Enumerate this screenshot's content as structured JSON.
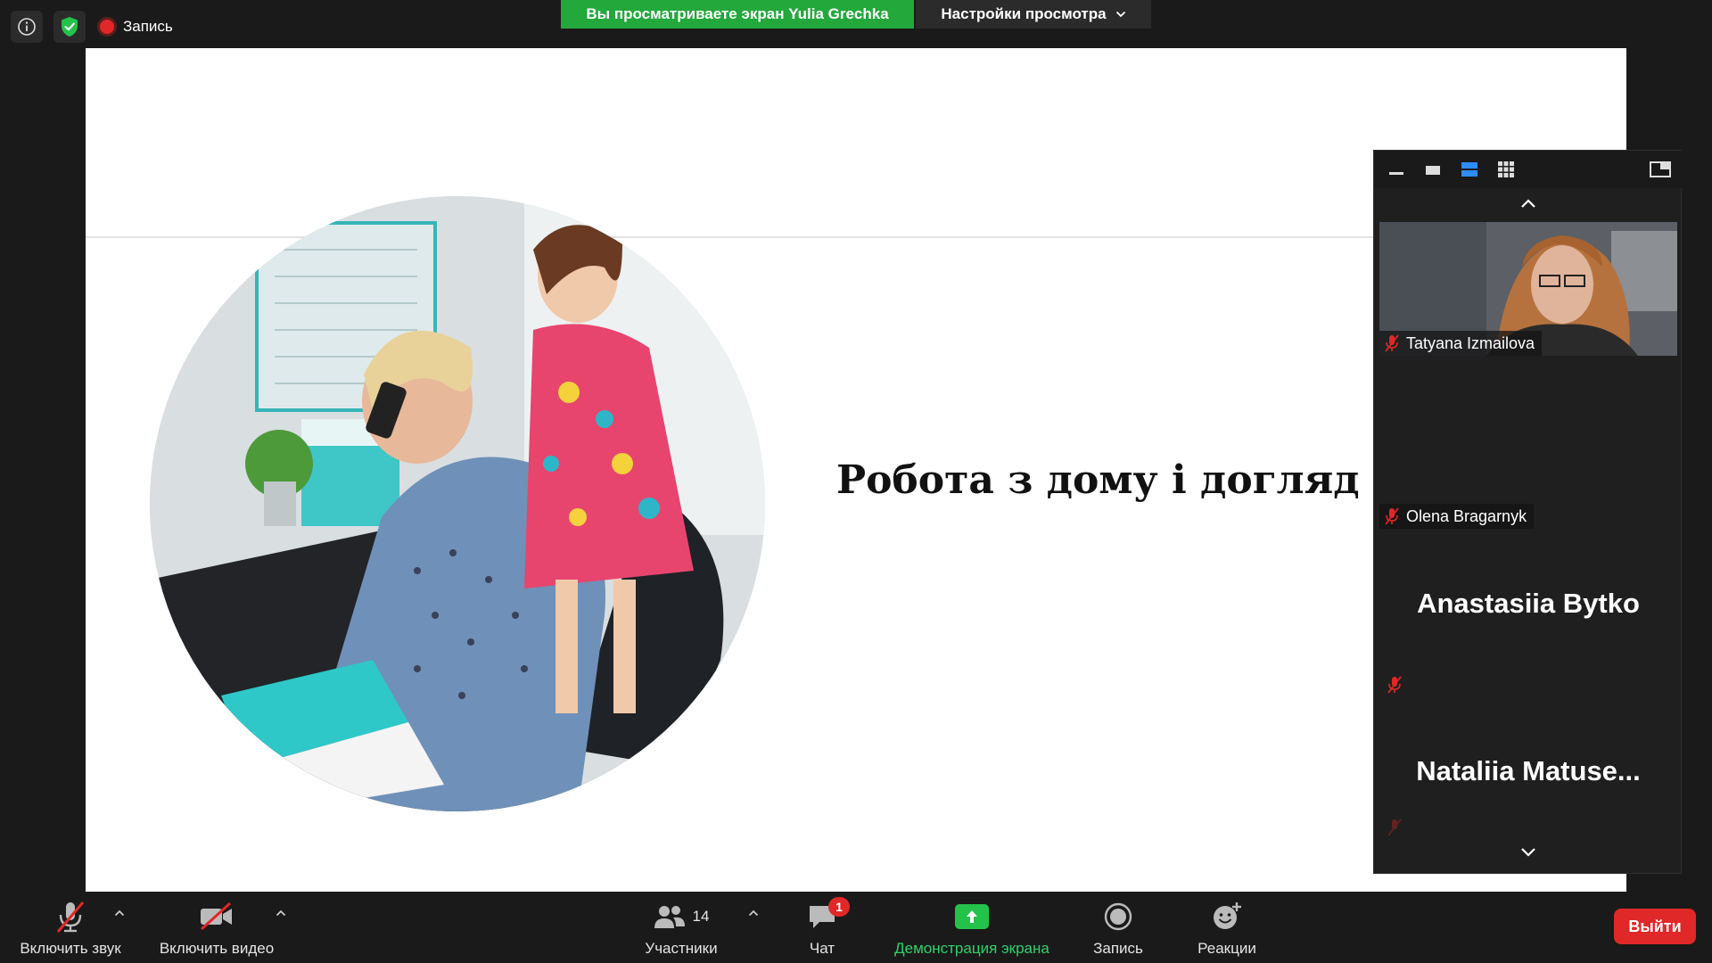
{
  "topbar": {
    "recording_label": "Запись",
    "viewing_banner": "Вы просматриваете экран Yulia Grechka",
    "view_options": "Настройки просмотра"
  },
  "slide": {
    "title": "Робота з дому і догляд за дітьми"
  },
  "gallery": {
    "participants": [
      {
        "name": "Tatyana Izmailova",
        "muted": true,
        "video": true
      },
      {
        "name": "Olena Bragarnyk",
        "muted": true,
        "video": false
      },
      {
        "name": "Anastasiia Bytko",
        "muted": true,
        "video": false
      },
      {
        "name": "Nataliia  Matuse...",
        "muted": true,
        "video": false
      }
    ]
  },
  "toolbar": {
    "unmute_label": "Включить звук",
    "video_label": "Включить видео",
    "participants_label": "Участники",
    "participants_count": "14",
    "chat_label": "Чат",
    "chat_badge": "1",
    "share_label": "Демонстрация экрана",
    "record_label": "Запись",
    "reactions_label": "Реакции",
    "leave_label": "Выйти"
  },
  "colors": {
    "share_green": "#23c24a",
    "banner_green": "#23a83c",
    "leave_red": "#e02828",
    "muted_red": "#e02828"
  }
}
